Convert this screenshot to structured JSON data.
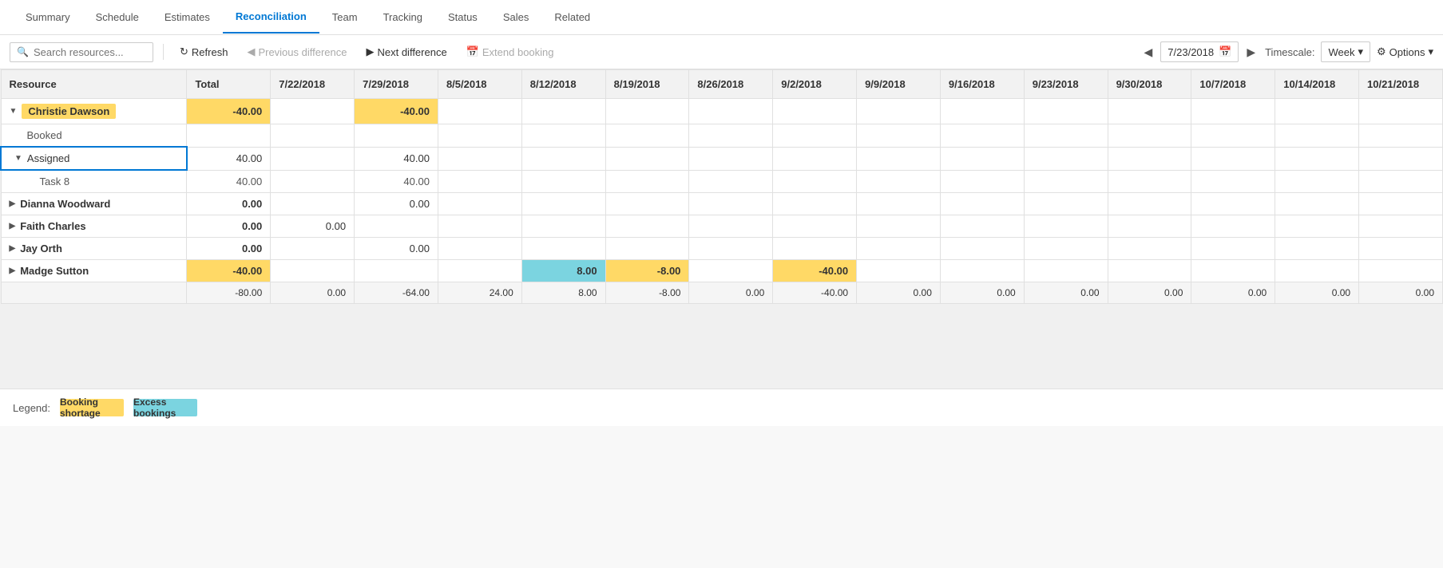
{
  "nav": {
    "items": [
      {
        "label": "Summary",
        "active": false
      },
      {
        "label": "Schedule",
        "active": false
      },
      {
        "label": "Estimates",
        "active": false
      },
      {
        "label": "Reconciliation",
        "active": true
      },
      {
        "label": "Team",
        "active": false
      },
      {
        "label": "Tracking",
        "active": false
      },
      {
        "label": "Status",
        "active": false
      },
      {
        "label": "Sales",
        "active": false
      },
      {
        "label": "Related",
        "active": false
      }
    ]
  },
  "toolbar": {
    "search_placeholder": "Search resources...",
    "refresh_label": "Refresh",
    "prev_diff_label": "Previous difference",
    "next_diff_label": "Next difference",
    "extend_booking_label": "Extend booking",
    "date_value": "7/23/2018",
    "timescale_label": "Timescale:",
    "timescale_value": "Week",
    "options_label": "Options"
  },
  "grid": {
    "headers": [
      "Resource",
      "Total",
      "7/22/2018",
      "7/29/2018",
      "8/5/2018",
      "8/12/2018",
      "8/19/2018",
      "8/26/2018",
      "9/2/2018",
      "9/9/2018",
      "9/16/2018",
      "9/23/2018",
      "9/30/2018",
      "10/7/2018",
      "10/14/2018",
      "10/21/2018"
    ],
    "rows": [
      {
        "type": "resource-main",
        "name": "Christie Dawson",
        "highlighted": true,
        "values": [
          "",
          "-40.00",
          "",
          "-40.00",
          "",
          "",
          "",
          "",
          "",
          "",
          "",
          "",
          "",
          "",
          "",
          ""
        ]
      },
      {
        "type": "booked",
        "name": "Booked",
        "values": [
          "",
          "",
          "",
          "",
          "",
          "",
          "",
          "",
          "",
          "",
          "",
          "",
          "",
          "",
          "",
          ""
        ]
      },
      {
        "type": "assigned",
        "name": "Assigned",
        "values": [
          "",
          "40.00",
          "",
          "40.00",
          "",
          "",
          "",
          "",
          "",
          "",
          "",
          "",
          "",
          "",
          "",
          ""
        ]
      },
      {
        "type": "task",
        "name": "Task 8",
        "values": [
          "",
          "40.00",
          "",
          "40.00",
          "",
          "",
          "",
          "",
          "",
          "",
          "",
          "",
          "",
          "",
          "",
          ""
        ]
      },
      {
        "type": "resource-main",
        "name": "Dianna Woodward",
        "highlighted": false,
        "values": [
          "",
          "0.00",
          "",
          "0.00",
          "",
          "",
          "",
          "",
          "",
          "",
          "",
          "",
          "",
          "",
          "",
          ""
        ]
      },
      {
        "type": "resource-main",
        "name": "Faith Charles",
        "highlighted": false,
        "values": [
          "",
          "0.00",
          "0.00",
          "",
          "",
          "",
          "",
          "",
          "",
          "",
          "",
          "",
          "",
          "",
          "",
          ""
        ]
      },
      {
        "type": "resource-main",
        "name": "Jay Orth",
        "highlighted": false,
        "values": [
          "",
          "0.00",
          "",
          "0.00",
          "",
          "",
          "",
          "",
          "",
          "",
          "",
          "",
          "",
          "",
          "",
          ""
        ]
      },
      {
        "type": "resource-main",
        "name": "Madge Sutton",
        "highlighted": false,
        "values": [
          "",
          "-40.00",
          "",
          "",
          "",
          "8.00",
          "-8.00",
          "",
          "-40.00",
          "",
          "",
          "",
          "",
          "",
          "",
          ""
        ]
      },
      {
        "type": "total",
        "name": "",
        "values": [
          "",
          "-80.00",
          "0.00",
          "-64.00",
          "24.00",
          "8.00",
          "-8.00",
          "0.00",
          "-40.00",
          "0.00",
          "0.00",
          "0.00",
          "0.00",
          "0.00",
          "0.00",
          "0.00"
        ]
      }
    ],
    "cell_highlights": {
      "christie_total": "yellow",
      "christie_729": "yellow",
      "madge_total": "yellow",
      "madge_812": "cyan",
      "madge_819": "yellow",
      "madge_92": "yellow"
    }
  },
  "legend": {
    "label": "Legend:",
    "items": [
      {
        "label": "Booking shortage",
        "color": "yellow"
      },
      {
        "label": "Excess bookings",
        "color": "cyan"
      }
    ]
  }
}
